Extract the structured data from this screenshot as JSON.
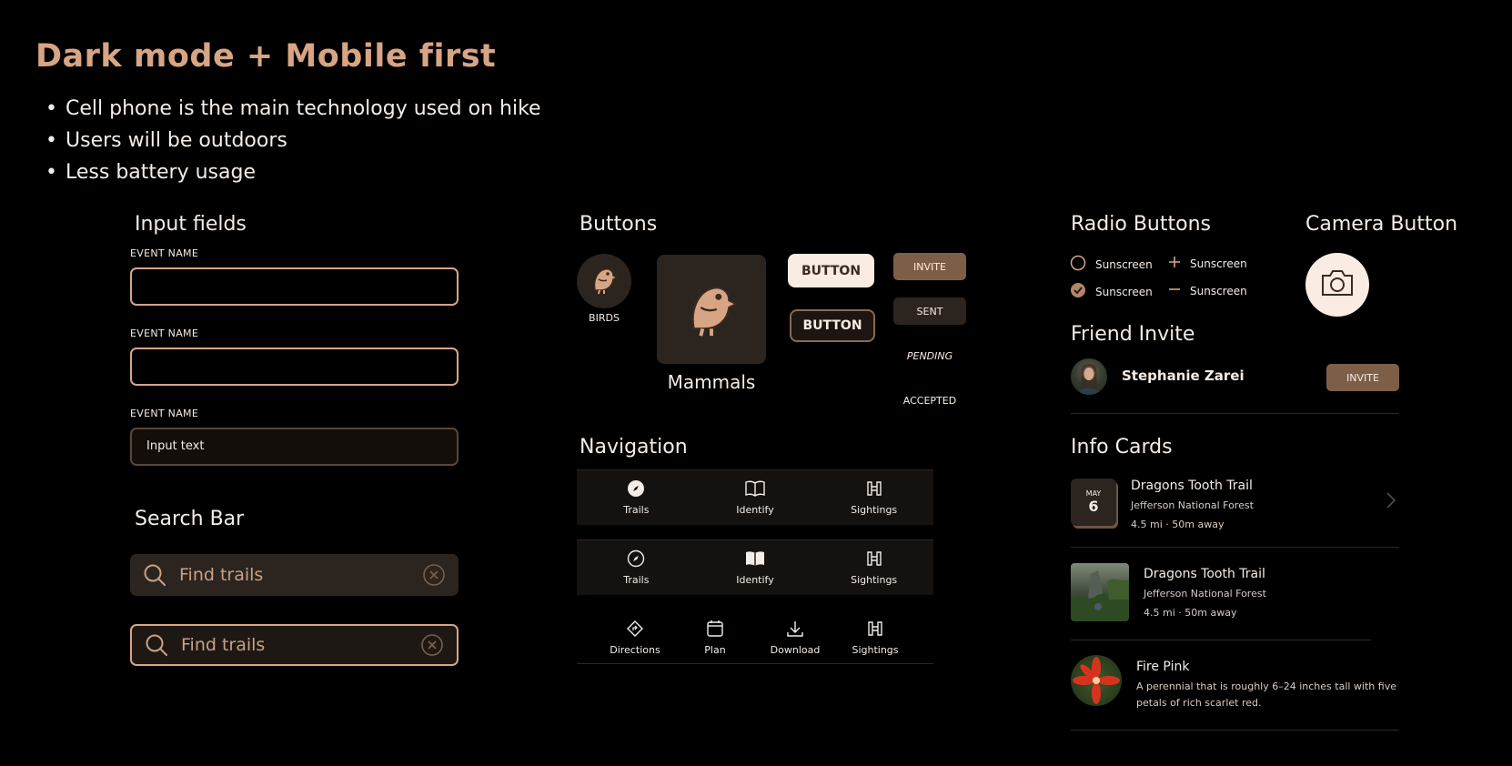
{
  "header": {
    "title": "Dark mode + Mobile first",
    "bullets": [
      "Cell phone is the main technology used on hike",
      "Users will be outdoors",
      "Less battery usage"
    ]
  },
  "inputs": {
    "title": "Input fields",
    "fields": [
      {
        "label": "EVENT NAME",
        "value": ""
      },
      {
        "label": "EVENT NAME",
        "value": ""
      },
      {
        "label": "EVENT NAME",
        "value": "Input text"
      }
    ]
  },
  "search": {
    "title": "Search Bar",
    "bars": [
      {
        "placeholder": "Find trails",
        "state": "default"
      },
      {
        "placeholder": "Find trails",
        "state": "focused"
      }
    ]
  },
  "buttons": {
    "title": "Buttons",
    "category_small": "BIRDS",
    "category_large": "Mammals",
    "primary_label": "BUTTON",
    "secondary_label": "BUTTON",
    "invite_label": "INVITE",
    "sent_label": "SENT",
    "pending_label": "PENDING",
    "accepted_label": "ACCEPTED"
  },
  "navigation": {
    "title": "Navigation",
    "bars": [
      {
        "items": [
          {
            "label": "Trails",
            "icon": "compass-icon",
            "active": true
          },
          {
            "label": "Identify",
            "icon": "book-icon",
            "active": false
          },
          {
            "label": "Sightings",
            "icon": "binoculars-icon",
            "active": false
          }
        ]
      },
      {
        "items": [
          {
            "label": "Trails",
            "icon": "compass-icon",
            "active": false
          },
          {
            "label": "Identify",
            "icon": "book-icon",
            "active": true
          },
          {
            "label": "Sightings",
            "icon": "binoculars-icon",
            "active": false
          }
        ]
      },
      {
        "items": [
          {
            "label": "Directions",
            "icon": "directions-icon"
          },
          {
            "label": "Plan",
            "icon": "calendar-icon"
          },
          {
            "label": "Download",
            "icon": "download-icon"
          },
          {
            "label": "Sightings",
            "icon": "binoculars-icon"
          }
        ]
      }
    ]
  },
  "radio": {
    "title": "Radio Buttons",
    "items": [
      {
        "label": "Sunscreen",
        "type": "radio-empty"
      },
      {
        "label": "Sunscreen",
        "type": "plus"
      },
      {
        "label": "Sunscreen",
        "type": "radio-checked"
      },
      {
        "label": "Sunscreen",
        "type": "minus"
      }
    ]
  },
  "camera": {
    "title": "Camera Button",
    "icon": "camera-icon"
  },
  "friend": {
    "title": "Friend Invite",
    "name": "Stephanie Zarei",
    "invite_label": "INVITE"
  },
  "info": {
    "title": "Info Cards",
    "cards": [
      {
        "month": "MAY",
        "day": "6",
        "title": "Dragons Tooth Trail",
        "subtitle": "Jefferson National Forest",
        "meta": "4.5 mi · 50m away"
      },
      {
        "title": "Dragons Tooth Trail",
        "subtitle": "Jefferson National Forest",
        "meta": "4.5 mi · 50m away"
      },
      {
        "title": "Fire Pink",
        "desc_line1": "A perennial that is roughly 6–24 inches tall with five",
        "desc_line2": "petals of rich scarlet red."
      }
    ]
  },
  "colors": {
    "accent": "#d8a584",
    "surface": "#2b241f",
    "text": "#f4ece6",
    "button_brown": "#7d5f48"
  }
}
